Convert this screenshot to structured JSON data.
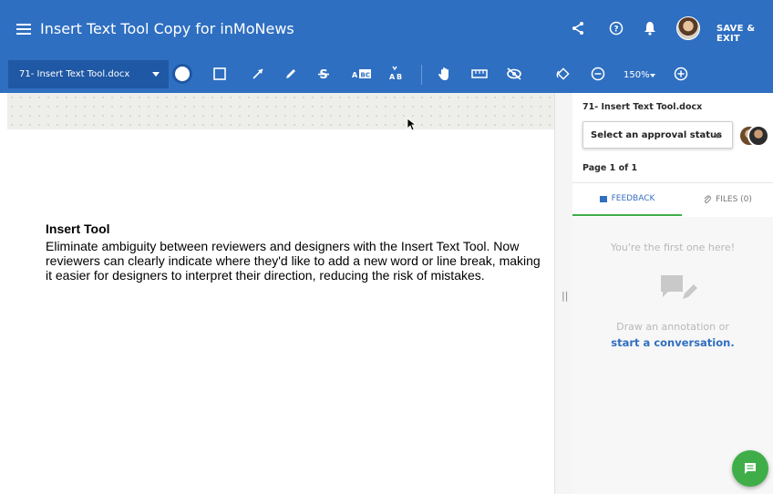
{
  "header": {
    "title": "Insert Text Tool Copy for inMoNews",
    "save_exit": "SAVE & EXIT",
    "icons": [
      "menu-icon",
      "share-icon",
      "help-icon",
      "bell-icon",
      "avatar"
    ]
  },
  "toolbar": {
    "file_name": "71- Insert Text Tool.docx",
    "zoom": "150%",
    "tools": [
      "circle",
      "rectangle",
      "arrow",
      "pen",
      "strikethrough",
      "replace-text",
      "insert-text",
      "pan",
      "measure",
      "hide-annotations",
      "rotate",
      "zoom-out",
      "zoom-in"
    ]
  },
  "document": {
    "heading": "Insert Tool",
    "body": "Eliminate ambiguity between reviewers and designers with the Insert Text Tool. Now reviewers can clearly indicate where they'd like to add a new word or line break, making it easier for designers to interpret their direction, reducing the risk of mistakes."
  },
  "panel": {
    "file_name": "71- Insert Text Tool.docx",
    "approval_placeholder": "Select an approval status",
    "page_info": "Page 1 of 1",
    "tabs": [
      {
        "label": "FEEDBACK",
        "icon": "flag-icon"
      },
      {
        "label": "FILES (0)",
        "icon": "paperclip-icon"
      }
    ],
    "empty_first": "You're the first one here!",
    "empty_hint": "Draw an annotation or",
    "empty_link": "start a conversation."
  },
  "colors": {
    "brand": "#2f6fc1",
    "toolbar_dark": "#1f58a4",
    "accent_green": "#3fae49"
  }
}
